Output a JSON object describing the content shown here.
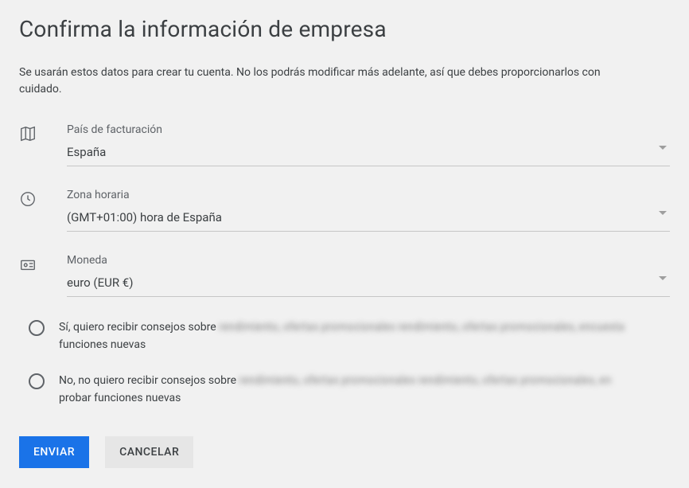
{
  "title": "Confirma la información de empresa",
  "subtitle": "Se usarán estos datos para crear tu cuenta. No los podrás modificar más adelante, así que debes proporcionarlos con cuidado.",
  "fields": {
    "country": {
      "label": "País de facturación",
      "value": "España"
    },
    "timezone": {
      "label": "Zona horaria",
      "value": "(GMT+01:00) hora de España"
    },
    "currency": {
      "label": "Moneda",
      "value": "euro (EUR €)"
    }
  },
  "radios": {
    "yes": {
      "prefix": "Sí, quiero recibir consejos sobre ",
      "blurred": "rendimiento, ofertas promocionales rendimiento, ofertas promocionales, encuesta",
      "suffix": " funciones nuevas"
    },
    "no": {
      "prefix": "No, no quiero recibir consejos sobre ",
      "blurred": "rendimiento, ofertas promocionales rendimiento, ofertas promocionales, en",
      "suffix": " probar funciones nuevas"
    }
  },
  "buttons": {
    "submit": "Enviar",
    "cancel": "Cancelar"
  }
}
